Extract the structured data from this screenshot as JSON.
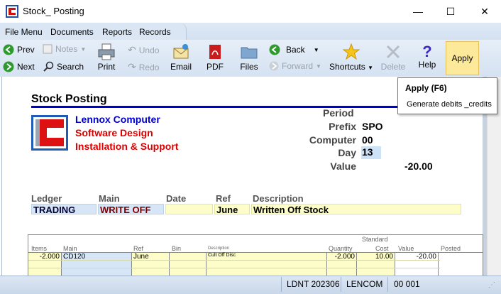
{
  "window": {
    "title": "Stock_ Posting",
    "minimize": "—",
    "maximize": "☐",
    "close": "✕"
  },
  "menu": [
    "File Menu",
    "Documents",
    "Reports",
    "Records"
  ],
  "toolbar": {
    "prev": "Prev",
    "next": "Next",
    "notes": "Notes",
    "search": "Search",
    "print": "Print",
    "undo": "Undo",
    "redo": "Redo",
    "email": "Email",
    "pdf": "PDF",
    "files": "Files",
    "back": "Back",
    "forward": "Forward",
    "shortcuts": "Shortcuts",
    "delete": "Delete",
    "help": "Help",
    "apply": "Apply"
  },
  "tooltip": {
    "title": "Apply (F6)",
    "body": "Generate debits _credits"
  },
  "doc": {
    "title": "Stock Posting",
    "company": [
      "Lennox Computer",
      "Software Design",
      "Installation & Support"
    ],
    "fields": {
      "period_label": "Period",
      "prefix_label": "Prefix",
      "prefix": "SPO",
      "computer_label": "Computer",
      "computer": "00",
      "day_label": "Day",
      "day": "13",
      "value_label": "Value",
      "value": "-20.00"
    },
    "header": {
      "ledger": "Ledger",
      "main": "Main",
      "date": "Date",
      "ref": "Ref",
      "description": "Description",
      "ledger_val": "TRADING",
      "main_val": "WRITE OFF",
      "date_val": "",
      "ref_val": "June",
      "description_val": "Written Off Stock"
    }
  },
  "grid": {
    "columns": {
      "items": "Items",
      "main": "Main",
      "ref": "Ref",
      "bin": "Bin",
      "description": "Description",
      "quantity": "Quantity",
      "standard": "Standard",
      "cost": "Cost",
      "value": "Value",
      "posted": "Posted"
    },
    "rows": [
      {
        "items": "-2.000",
        "main": "CD120",
        "ref": "June",
        "bin": "",
        "description": "Cult Off Disc",
        "quantity": "-2.000",
        "cost": "10.00",
        "value": "-20.00",
        "posted": ""
      }
    ]
  },
  "status": {
    "ldnt": "LDNT 202306",
    "lencom": "LENCOM",
    "code": "00 001"
  },
  "colors": {
    "accent": "#0000cc",
    "company_blue": "#0000cc",
    "company_red": "#dd0000",
    "apply_bg": "#fde99a"
  }
}
